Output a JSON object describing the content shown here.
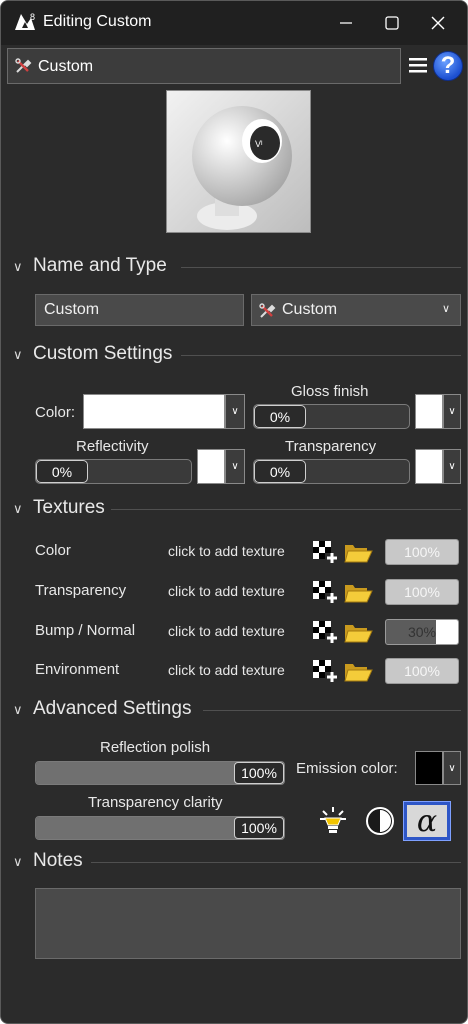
{
  "window": {
    "title": "Editing Custom"
  },
  "header": {
    "preset": "Custom",
    "icons": {
      "menu": "hamburger-menu-icon",
      "help": "help-icon"
    }
  },
  "name_and_type": {
    "title": "Name and Type",
    "name_value": "Custom",
    "type_value": "Custom"
  },
  "custom_settings": {
    "title": "Custom Settings",
    "color_label": "Color:",
    "color_value": "#ffffff",
    "gloss_label": "Gloss finish",
    "gloss_value": "0%",
    "reflectivity_label": "Reflectivity",
    "reflectivity_value": "0%",
    "transparency_label": "Transparency",
    "transparency_value": "0%"
  },
  "textures": {
    "title": "Textures",
    "items": [
      {
        "label": "Color",
        "action": "click to add texture",
        "amount": "100%",
        "level": 100,
        "enabled": false
      },
      {
        "label": "Transparency",
        "action": "click to add texture",
        "amount": "100%",
        "level": 100,
        "enabled": false
      },
      {
        "label": "Bump / Normal",
        "action": "click to add texture",
        "amount": "30%",
        "level": 30,
        "enabled": true
      },
      {
        "label": "Environment",
        "action": "click to add texture",
        "amount": "100%",
        "level": 100,
        "enabled": false
      }
    ]
  },
  "advanced": {
    "title": "Advanced Settings",
    "reflection_polish_label": "Reflection polish",
    "reflection_polish_value": "100%",
    "transparency_clarity_label": "Transparency clarity",
    "transparency_clarity_value": "100%",
    "emission_label": "Emission color:",
    "emission_color": "#000000",
    "alpha_glyph": "α"
  },
  "notes": {
    "title": "Notes",
    "text": ""
  }
}
